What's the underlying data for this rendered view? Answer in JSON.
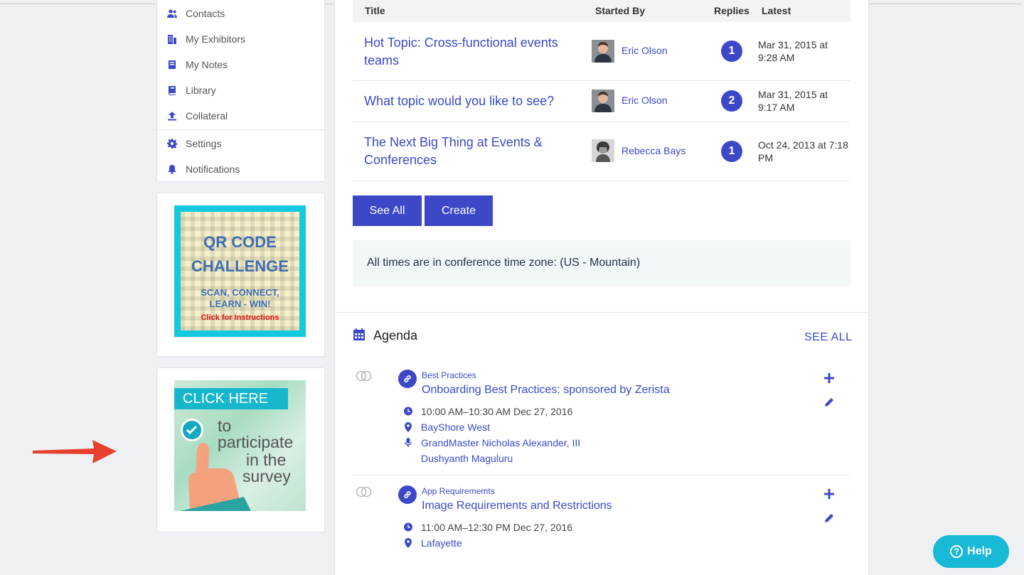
{
  "sidebar": {
    "items": [
      {
        "label": "Contacts",
        "icon": "contacts-icon"
      },
      {
        "label": "My Exhibitors",
        "icon": "building-icon"
      },
      {
        "label": "My Notes",
        "icon": "notebook-icon"
      },
      {
        "label": "Library",
        "icon": "book-icon"
      },
      {
        "label": "Collateral",
        "icon": "upload-icon"
      },
      {
        "label": "Settings",
        "icon": "gear-icon"
      },
      {
        "label": "Notifications",
        "icon": "bell-icon"
      }
    ]
  },
  "qr_promo": {
    "line1": "QR CODE",
    "line2": "CHALLENGE",
    "line3": "SCAN, CONNECT,",
    "line4": "LEARN - WIN!",
    "line5": "Click for Instructions"
  },
  "survey_promo": {
    "banner": "CLICK HERE",
    "line1": "to",
    "line2": "participate",
    "line3": "in the",
    "line4": "survey"
  },
  "discussions": {
    "columns": {
      "title": "Title",
      "started_by": "Started By",
      "replies": "Replies",
      "latest": "Latest"
    },
    "rows": [
      {
        "title": "Hot Topic: Cross-functional events teams",
        "author": "Eric Olson",
        "replies": "1",
        "latest": "Mar 31, 2015 at 9:28 AM"
      },
      {
        "title": "What topic would you like to see?",
        "author": "Eric Olson",
        "replies": "2",
        "latest": "Mar 31, 2015 at 9:17 AM"
      },
      {
        "title": "The Next Big Thing at Events & Conferences",
        "author": "Rebecca Bays",
        "replies": "1",
        "latest": "Oct 24, 2013 at 7:18 PM"
      }
    ],
    "see_all_label": "See All",
    "create_label": "Create"
  },
  "timezone_note": "All times are in conference time zone: (US - Mountain)",
  "agenda": {
    "title": "Agenda",
    "see_all": "SEE ALL",
    "sessions": [
      {
        "category": "Best Practices",
        "title": "Onboarding Best Practices: sponsored by Zerista",
        "time": "10:00 AM–10:30 AM Dec 27, 2016",
        "location": "BayShore West",
        "speakers": [
          "GrandMaster Nicholas Alexander, III",
          "Dushyanth Maguluru"
        ]
      },
      {
        "category": "App Requirememts",
        "title": "Image Requirements and Restrictions",
        "time": "11:00 AM–12:30 PM Dec 27, 2016",
        "location": "Lafayette"
      }
    ]
  },
  "help_label": "Help",
  "colors": {
    "accent": "#3d48c8",
    "help": "#17b9d6",
    "arrow": "#e8402f"
  }
}
